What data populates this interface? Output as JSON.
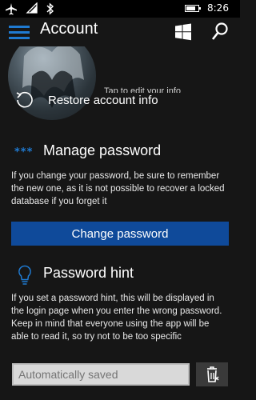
{
  "status_bar": {
    "time": "8:26",
    "icons": [
      "airplane-icon",
      "wifi-icon",
      "bluetooth-icon",
      "battery-icon"
    ],
    "battery_level": 0.8
  },
  "app_bar": {
    "title": "Account",
    "icons": [
      "hamburger-icon",
      "windows-icon",
      "search-icon"
    ]
  },
  "profile": {
    "tap_caption": "Tap to edit your info"
  },
  "restore": {
    "label": "Restore account info"
  },
  "manage_password": {
    "dots": "***",
    "title": "Manage password",
    "description": "If you change your password, be sure to remember the new one, as it is not possible to recover a locked database if you forget it",
    "button_label": "Change password"
  },
  "password_hint": {
    "title": "Password hint",
    "description": "If you set a password hint, this will be displayed in the login page when you enter the wrong password. Keep in mind that everyone using the app will be able to read it, so try not to be too specific",
    "input_placeholder": "Automatically saved",
    "input_value": ""
  },
  "colors": {
    "accent": "#1f7ad1",
    "button": "#0f4a9a",
    "background": "#161616"
  }
}
